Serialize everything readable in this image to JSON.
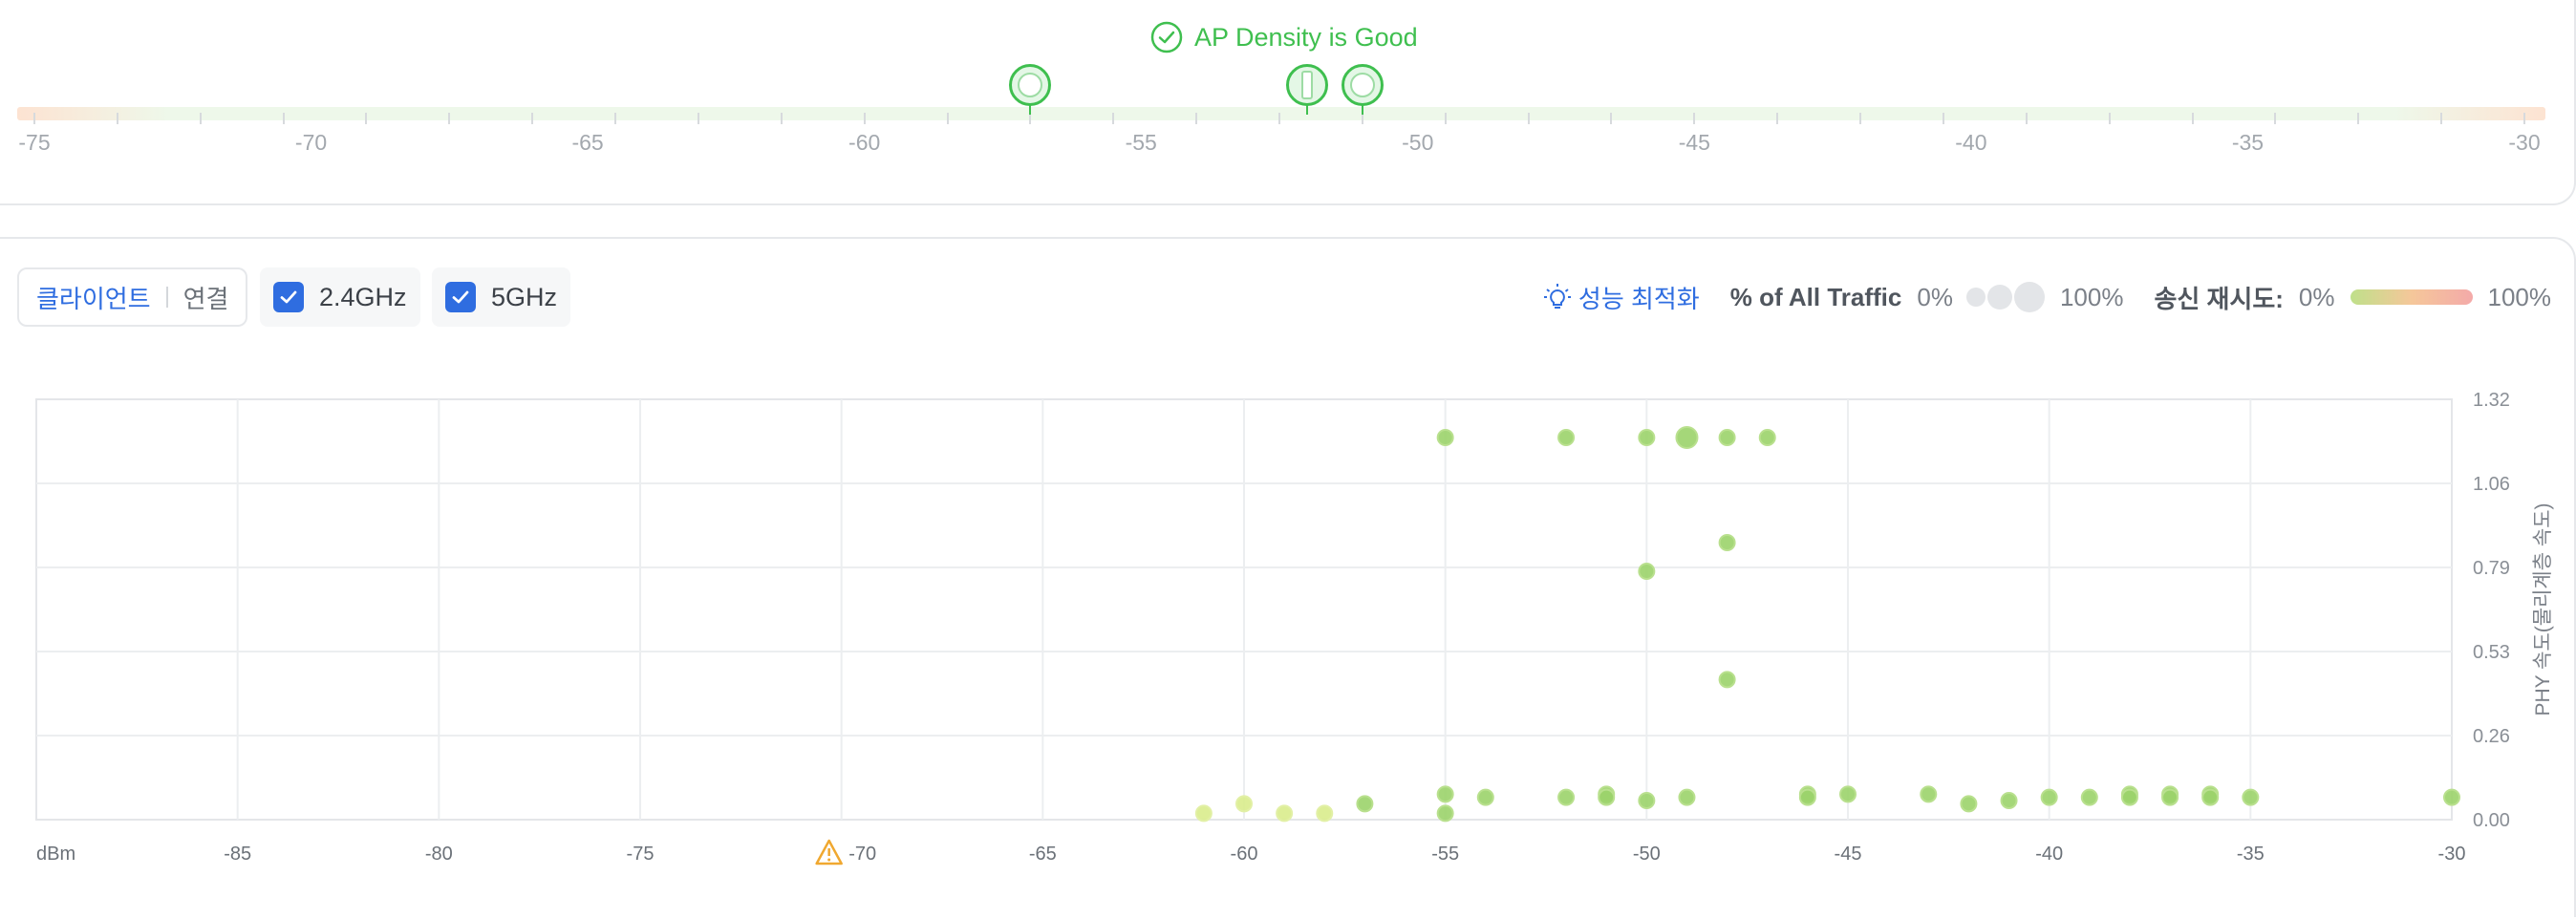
{
  "density": {
    "status_text": "AP Density is Good",
    "scale_labels": [
      "-75",
      "-70",
      "-65",
      "-60",
      "-55",
      "-50",
      "-45",
      "-40",
      "-35",
      "-30"
    ],
    "scale_min": -75,
    "scale_max": -30,
    "ap_markers": [
      {
        "value": -57,
        "icon": "ap-disc-icon"
      },
      {
        "value": -52,
        "icon": "ap-bar-icon"
      },
      {
        "value": -51,
        "icon": "ap-disc-icon"
      }
    ],
    "colors": {
      "good": "#3fbf4f"
    }
  },
  "toolbar": {
    "client_label": "클라이언트",
    "connect_label": "연결",
    "band_24": "2.4GHz",
    "band_5": "5GHz",
    "optimize_label": "성능 최적화",
    "traffic_title": "% of All Traffic",
    "traffic_min": "0%",
    "traffic_max": "100%",
    "retry_title": "송신 재시도:",
    "retry_min": "0%",
    "retry_max": "100%"
  },
  "chart_data": {
    "type": "scatter",
    "xlabel": "dBm",
    "ylabel": "PHY 속도(물리계층 속도)",
    "x_ticks": [
      "-85",
      "-80",
      "-75",
      "-70",
      "-65",
      "-60",
      "-55",
      "-50",
      "-45",
      "-40",
      "-35",
      "-30"
    ],
    "y_ticks": [
      "0.00",
      "0.26",
      "0.53",
      "0.79",
      "1.06",
      "1.32"
    ],
    "xlim": [
      -90,
      -30
    ],
    "ylim": [
      0,
      1.32
    ],
    "warning_tick": "-70",
    "points": [
      {
        "x": -55,
        "y": 1.2
      },
      {
        "x": -52,
        "y": 1.2
      },
      {
        "x": -50,
        "y": 1.2
      },
      {
        "x": -49,
        "y": 1.2
      },
      {
        "x": -48,
        "y": 1.2
      },
      {
        "x": -47,
        "y": 1.2
      },
      {
        "x": -48,
        "y": 0.87
      },
      {
        "x": -50,
        "y": 0.78
      },
      {
        "x": -48,
        "y": 0.44
      },
      {
        "x": -61,
        "y": 0.02
      },
      {
        "x": -60,
        "y": 0.05
      },
      {
        "x": -59,
        "y": 0.02
      },
      {
        "x": -58,
        "y": 0.02
      },
      {
        "x": -57,
        "y": 0.05
      },
      {
        "x": -55,
        "y": 0.08
      },
      {
        "x": -55,
        "y": 0.02
      },
      {
        "x": -54,
        "y": 0.07
      },
      {
        "x": -52,
        "y": 0.07
      },
      {
        "x": -51,
        "y": 0.08
      },
      {
        "x": -51,
        "y": 0.07
      },
      {
        "x": -50,
        "y": 0.06
      },
      {
        "x": -49,
        "y": 0.07
      },
      {
        "x": -46,
        "y": 0.08
      },
      {
        "x": -46,
        "y": 0.07
      },
      {
        "x": -45,
        "y": 0.08
      },
      {
        "x": -43,
        "y": 0.08
      },
      {
        "x": -42,
        "y": 0.05
      },
      {
        "x": -41,
        "y": 0.06
      },
      {
        "x": -40,
        "y": 0.07
      },
      {
        "x": -39,
        "y": 0.07
      },
      {
        "x": -38,
        "y": 0.08
      },
      {
        "x": -38,
        "y": 0.07
      },
      {
        "x": -37,
        "y": 0.08
      },
      {
        "x": -37,
        "y": 0.07
      },
      {
        "x": -36,
        "y": 0.08
      },
      {
        "x": -36,
        "y": 0.07
      },
      {
        "x": -35,
        "y": 0.07
      },
      {
        "x": -30,
        "y": 0.07
      }
    ],
    "grid": true,
    "colors": {
      "point": "#9bd36a",
      "point_low": "#d9ec8c"
    }
  }
}
